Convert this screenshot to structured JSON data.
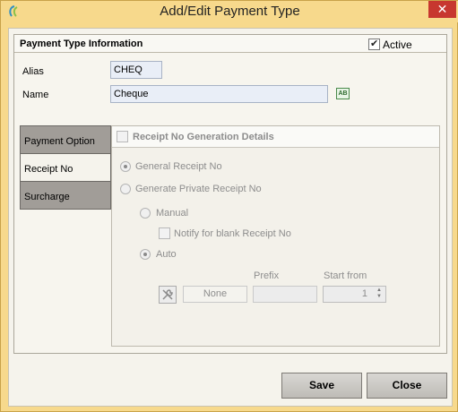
{
  "window": {
    "title": "Add/Edit Payment Type",
    "close_glyph": "✕"
  },
  "group": {
    "title": "Payment Type Information",
    "active_label": "Active",
    "active_checked": true
  },
  "fields": {
    "alias_label": "Alias",
    "alias_value": "CHEQ",
    "name_label": "Name",
    "name_value": "Cheque",
    "name_icon_text": "AB"
  },
  "side_tabs": [
    {
      "label": "Payment Option",
      "selected": false
    },
    {
      "label": "Receipt No",
      "selected": true
    },
    {
      "label": "Surcharge",
      "selected": false
    }
  ],
  "receipt": {
    "header_label": "Receipt No Generation Details",
    "general_label": "General Receipt No",
    "private_label": "Generate Private Receipt No",
    "manual_label": "Manual",
    "notify_label": "Notify for blank Receipt No",
    "auto_label": "Auto",
    "prefix_label": "Prefix",
    "start_from_label": "Start from",
    "none_value": "None",
    "prefix_value": "",
    "start_from_value": "1"
  },
  "buttons": {
    "save": "Save",
    "close": "Close"
  },
  "icons": {
    "app": "app-logo-icon",
    "tool": "wrench-icon"
  }
}
